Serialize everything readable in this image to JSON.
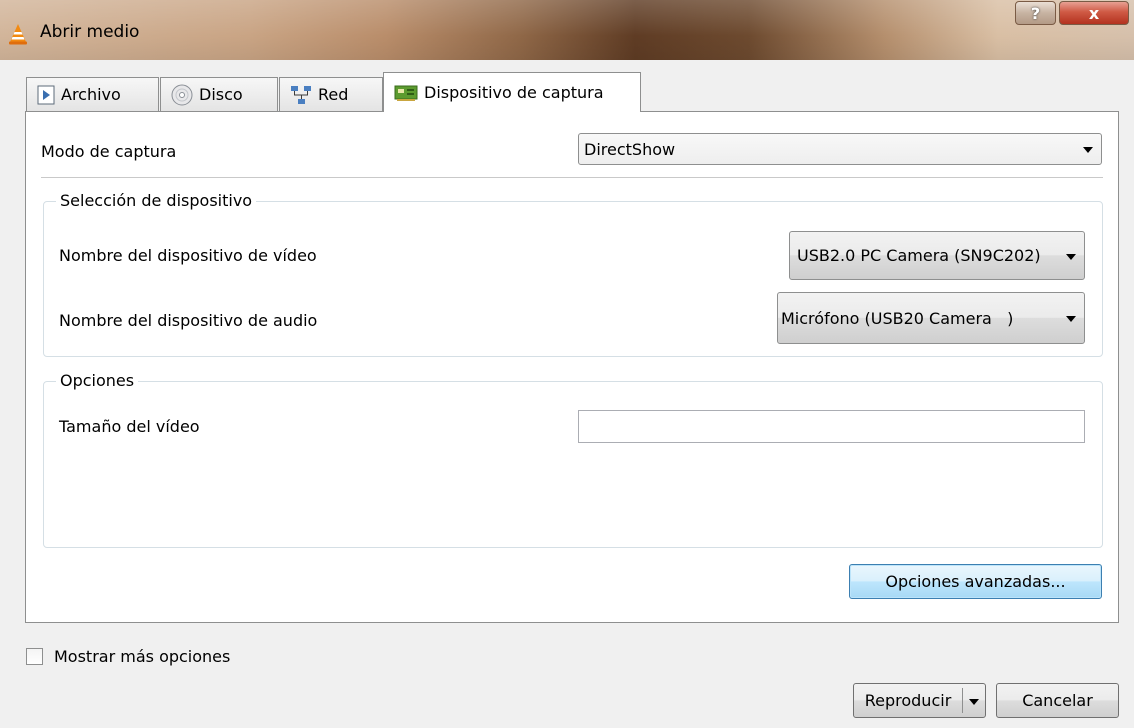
{
  "window": {
    "title": "Abrir medio",
    "help_label": "?",
    "close_label": "x"
  },
  "tabs": [
    {
      "label": "Archivo",
      "icon": "file-play-icon"
    },
    {
      "label": "Disco",
      "icon": "disc-icon"
    },
    {
      "label": "Red",
      "icon": "network-icon"
    },
    {
      "label": "Dispositivo de captura",
      "icon": "capture-card-icon",
      "active": true
    }
  ],
  "capture": {
    "mode_label": "Modo de captura",
    "mode_value": "DirectShow"
  },
  "device_group": {
    "title": "Selección de dispositivo",
    "video_label": "Nombre del dispositivo de vídeo",
    "video_value": "USB2.0 PC Camera (SN9C202)",
    "audio_label": "Nombre del dispositivo de audio",
    "audio_value": "Micrófono (USB20 Camera   )"
  },
  "options_group": {
    "title": "Opciones",
    "video_size_label": "Tamaño del vídeo",
    "video_size_value": ""
  },
  "advanced_button": "Opciones avanzadas...",
  "show_more_label": "Mostrar más opciones",
  "footer": {
    "play_label": "Reproducir",
    "cancel_label": "Cancelar"
  }
}
